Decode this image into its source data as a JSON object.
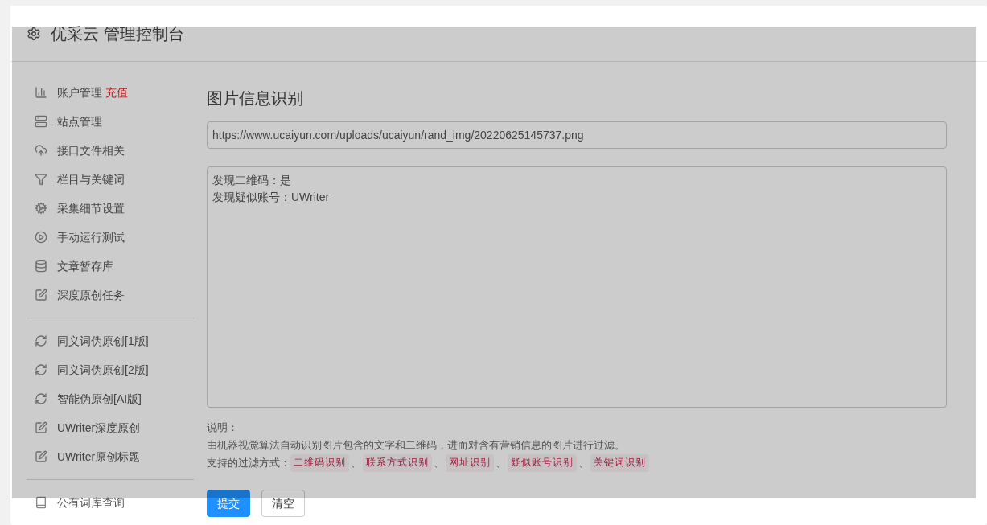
{
  "header": {
    "title": "优采云 管理控制台"
  },
  "sidebar": {
    "groups": [
      [
        {
          "label": "账户管理",
          "badge": "充值"
        },
        {
          "label": "站点管理"
        },
        {
          "label": "接口文件相关"
        },
        {
          "label": "栏目与关键词"
        },
        {
          "label": "采集细节设置"
        },
        {
          "label": "手动运行测试"
        },
        {
          "label": "文章暂存库"
        },
        {
          "label": "深度原创任务"
        }
      ],
      [
        {
          "label": "同义词伪原创[1版]"
        },
        {
          "label": "同义词伪原创[2版]"
        },
        {
          "label": "智能伪原创[AI版]"
        },
        {
          "label": "UWriter深度原创"
        },
        {
          "label": "UWriter原创标题"
        }
      ],
      [
        {
          "label": "公有词库查询"
        }
      ]
    ]
  },
  "main": {
    "title": "图片信息识别",
    "url_field": {
      "value": "https://www.ucaiyun.com/uploads/ucaiyun/rand_img/20220625145737.png"
    },
    "result_box": {
      "lines": [
        "发现二维码：是",
        "发现疑似账号：UWriter"
      ]
    },
    "notes": {
      "heading": "说明：",
      "description": "由机器视觉算法自动识别图片包含的文字和二维码，进而对含有营销信息的图片进行过滤。",
      "methods_label": "支持的过滤方式：",
      "separator": "、",
      "methods": [
        "二维码识别",
        "联系方式识别",
        "网址识别",
        "疑似账号识别",
        "关键词识别"
      ]
    },
    "buttons": [
      {
        "label": "提交",
        "kind": "primary"
      },
      {
        "label": "清空",
        "kind": "default"
      }
    ]
  }
}
